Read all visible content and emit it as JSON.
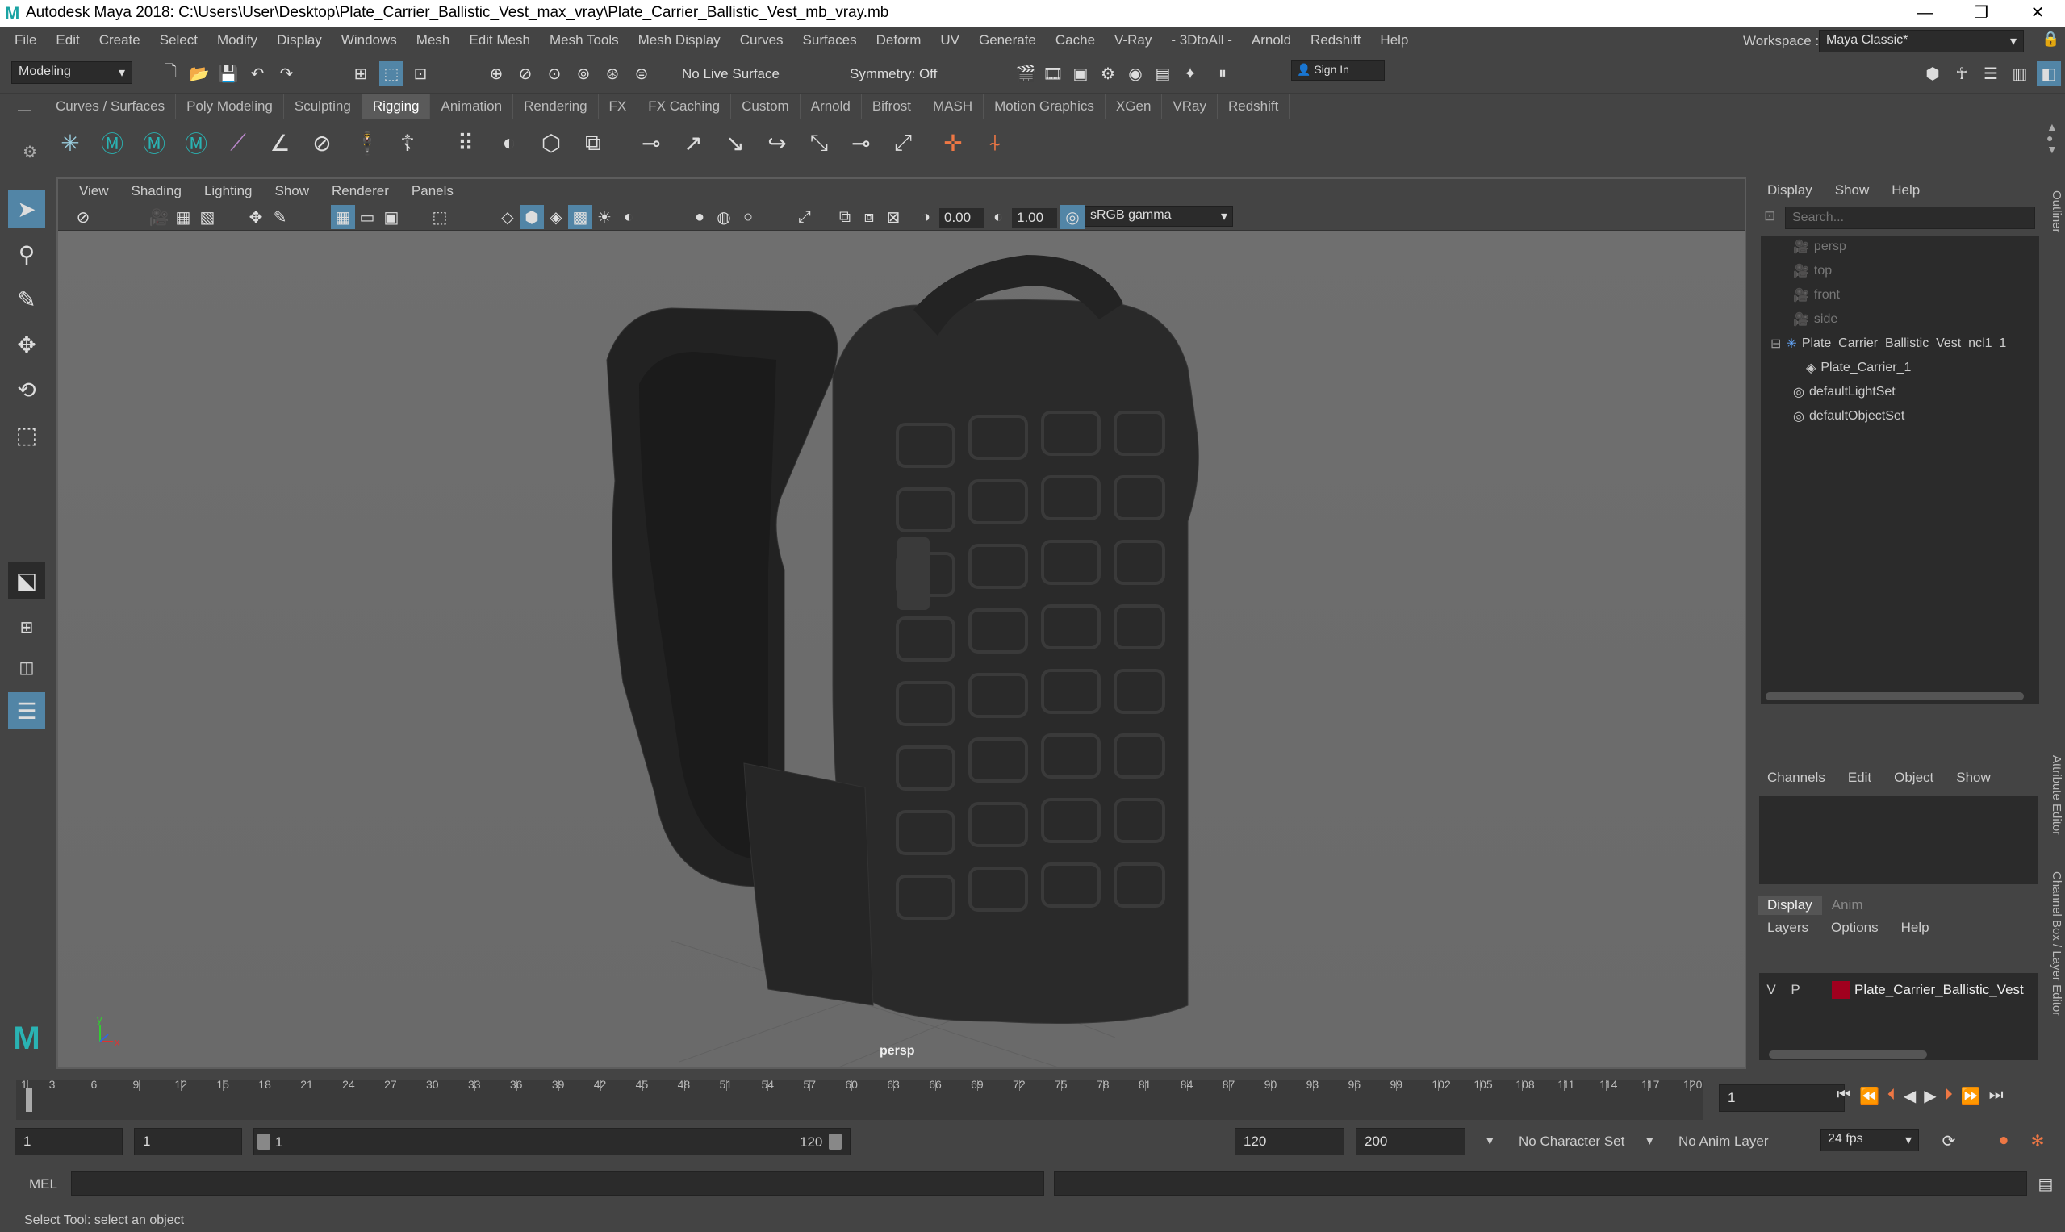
{
  "title_bar": {
    "title": "Autodesk Maya 2018: C:\\Users\\User\\Desktop\\Plate_Carrier_Ballistic_Vest_max_vray\\Plate_Carrier_Ballistic_Vest_mb_vray.mb",
    "minimize": "—",
    "maximize": "❐",
    "close": "✕"
  },
  "menu": [
    "File",
    "Edit",
    "Create",
    "Select",
    "Modify",
    "Display",
    "Windows",
    "Mesh",
    "Edit Mesh",
    "Mesh Tools",
    "Mesh Display",
    "Curves",
    "Surfaces",
    "Deform",
    "UV",
    "Generate",
    "Cache",
    "V-Ray",
    "- 3DtoAll -",
    "Arnold",
    "Redshift",
    "Help"
  ],
  "workspace": {
    "label": "Workspace :",
    "value": "Maya Classic*"
  },
  "status": {
    "mode": "Modeling",
    "live_surface": "No Live Surface",
    "symmetry": "Symmetry: Off",
    "sign_in": "Sign In"
  },
  "shelf_tabs": [
    "Curves / Surfaces",
    "Poly Modeling",
    "Sculpting",
    "Rigging",
    "Animation",
    "Rendering",
    "FX",
    "FX Caching",
    "Custom",
    "Arnold",
    "Bifrost",
    "MASH",
    "Motion Graphics",
    "XGen",
    "VRay",
    "Redshift"
  ],
  "shelf_active": "Rigging",
  "viewport": {
    "menu": [
      "View",
      "Shading",
      "Lighting",
      "Show",
      "Renderer",
      "Panels"
    ],
    "exposure": "0.00",
    "gamma": "1.00",
    "color_space": "sRGB gamma",
    "camera_label": "persp"
  },
  "outliner": {
    "menu": [
      "Display",
      "Show",
      "Help"
    ],
    "search_placeholder": "Search...",
    "items": [
      "persp",
      "top",
      "front",
      "side",
      "Plate_Carrier_Ballistic_Vest_ncl1_1",
      "Plate_Carrier_1",
      "defaultLightSet",
      "defaultObjectSet"
    ],
    "side_tab": "Outliner"
  },
  "channel_box": {
    "menu": [
      "Channels",
      "Edit",
      "Object",
      "Show"
    ]
  },
  "layer_editor": {
    "tabs": [
      "Display",
      "Anim"
    ],
    "menu": [
      "Layers",
      "Options",
      "Help"
    ],
    "layer": {
      "v": "V",
      "p": "P",
      "name": "Plate_Carrier_Ballistic_Vest",
      "color": "#a0001e"
    }
  },
  "side_tabs": {
    "attr": "Attribute Editor",
    "channel": "Channel Box / Layer Editor"
  },
  "timeline": {
    "ticks": [
      "1",
      "3",
      "6",
      "9",
      "12",
      "15",
      "18",
      "21",
      "24",
      "27",
      "30",
      "33",
      "36",
      "39",
      "42",
      "45",
      "48",
      "51",
      "54",
      "57",
      "60",
      "63",
      "66",
      "69",
      "72",
      "75",
      "78",
      "81",
      "84",
      "87",
      "90",
      "93",
      "96",
      "99",
      "102",
      "105",
      "108",
      "111",
      "114",
      "117",
      "120"
    ],
    "current_frame": "1"
  },
  "range": {
    "start": "1",
    "playback_start": "1",
    "slider_start": "1",
    "slider_end": "120",
    "playback_end": "120",
    "end": "200",
    "char_set": "No Character Set",
    "anim_layer": "No Anim Layer",
    "fps": "24 fps"
  },
  "cmd": {
    "label": "MEL"
  },
  "help_line": "Select Tool: select an object",
  "accent": "#5285a6"
}
